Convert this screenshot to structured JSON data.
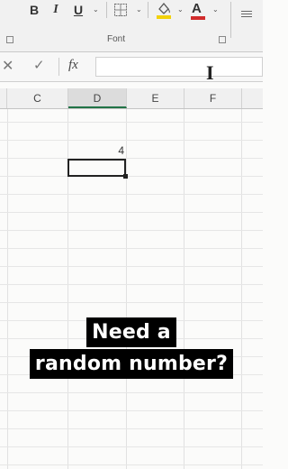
{
  "ribbon": {
    "bold_label": "B",
    "italic_label": "I",
    "underline_label": "U",
    "font_group_label": "Font",
    "font_color_letter": "A",
    "accent_underline_color": "#d12c2c",
    "fill_color": "#f2d10a"
  },
  "formula_bar": {
    "cancel_glyph": "✕",
    "enter_glyph": "✓",
    "fx_label": "fx",
    "value": ""
  },
  "columns": [
    "C",
    "D",
    "E",
    "F"
  ],
  "active_column": "D",
  "cell": {
    "value": "4"
  },
  "caption": {
    "line1": "Need a",
    "line2": "random number?"
  }
}
